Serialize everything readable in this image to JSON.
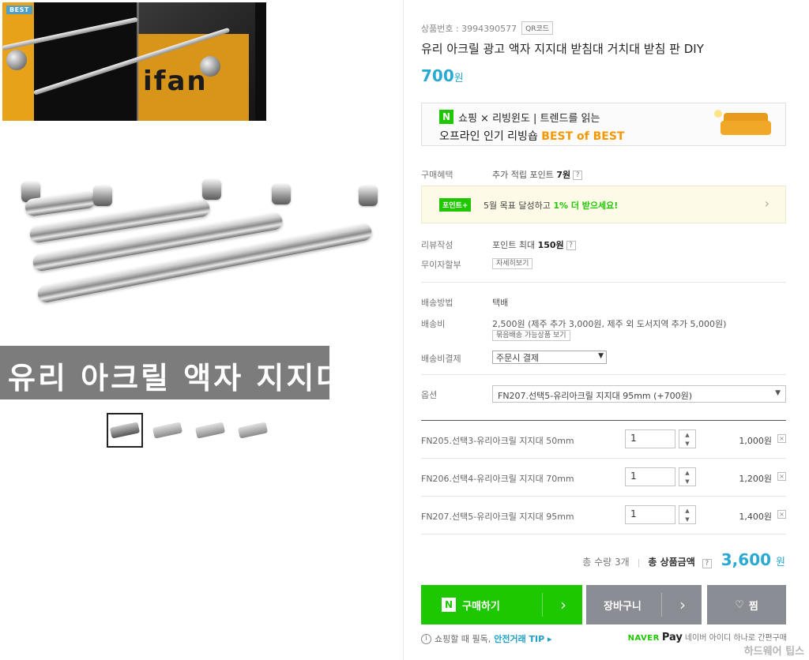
{
  "gallery": {
    "best_badge": "BEST",
    "caption": "유리 아크릴 액자 지지대",
    "top_photo_logo": "ifan"
  },
  "product": {
    "number_label": "상품번호 : 3994390577",
    "qr_label": "QR코드",
    "title": "유리 아크릴 광고 액자 지지대 받침대 거치대 받침 판 DIY",
    "price": "700",
    "price_unit": "원"
  },
  "banner": {
    "n_logo": "N",
    "line1": "쇼핑 × 리빙윈도 | 트렌드를 읽는",
    "line2_prefix": "오프라인 인기 리빙숍 ",
    "line2_highlight": "BEST of BEST"
  },
  "benefits": {
    "purchase_label": "구매혜택",
    "purchase_value_prefix": "추가 적립 포인트 ",
    "purchase_value_bold": "7원",
    "point_badge": "포인트+",
    "point_text_prefix": "5월 목표 달성하고 ",
    "point_text_highlight": "1% 더 받으세요!",
    "review_label": "리뷰작성",
    "review_value_prefix": "포인트 최대 ",
    "review_value_bold": "150원",
    "installment_label": "무이자할부",
    "installment_button": "자세히보기"
  },
  "shipping": {
    "method_label": "배송방법",
    "method_value": "택배",
    "fee_label": "배송비",
    "fee_value": "2,500원 (제주 추가 3,000원, 제주 외 도서지역 추가 5,000원)",
    "bundle_button": "묶음배송 가능상품 보기",
    "payment_label": "배송비결제",
    "payment_value": "주문시 결제"
  },
  "options": {
    "label": "옵션",
    "selected": "FN207.선택5-유리아크릴 지지대 95mm (+700원)"
  },
  "selected_items": [
    {
      "name": "FN205.선택3-유리아크릴 지지대 50mm",
      "qty": "1",
      "price": "1,000원"
    },
    {
      "name": "FN206.선택4-유리아크릴 지지대 70mm",
      "qty": "1",
      "price": "1,200원"
    },
    {
      "name": "FN207.선택5-유리아크릴 지지대 95mm",
      "qty": "1",
      "price": "1,400원"
    }
  ],
  "total": {
    "qty": "총 수량 3개",
    "label": "총 상품금액",
    "amount": "3,600",
    "unit": "원"
  },
  "actions": {
    "buy": "구매하기",
    "cart": "장바구니",
    "wish": "찜"
  },
  "footer": {
    "safe_text": "쇼핑할 때 필독, ",
    "safe_link": "안전거래 TIP",
    "naver": "NAVER",
    "pay": "Pay",
    "naver_text": "네이버 아이디 하나로 간편구매",
    "watermark": "하드웨어 팁스"
  },
  "colors": {
    "naver_green": "#1ec800",
    "price_blue": "#2aa9d2",
    "button_gray": "#8a8d93",
    "highlight_orange": "#f39800"
  }
}
